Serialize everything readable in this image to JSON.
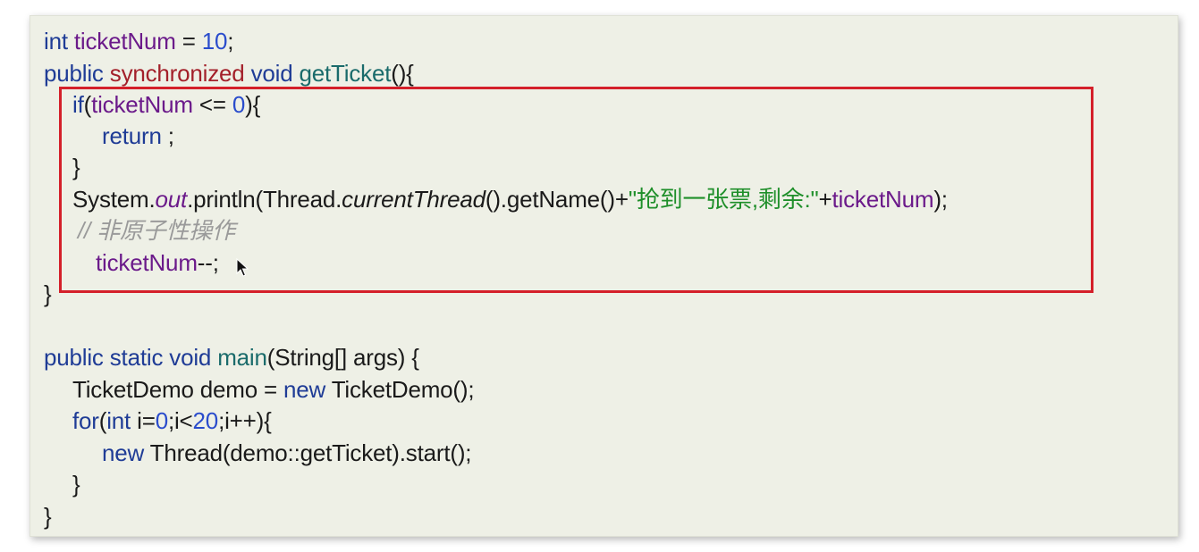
{
  "code": {
    "lines": [
      {
        "tokens": [
          {
            "t": "int",
            "c": "kw"
          },
          {
            "t": " ticketNum ",
            "c": "field"
          },
          {
            "t": "= ",
            "c": ""
          },
          {
            "t": "10",
            "c": "num"
          },
          {
            "t": ";",
            "c": ""
          }
        ]
      },
      {
        "tokens": [
          {
            "t": "public ",
            "c": "kw"
          },
          {
            "t": "synchronized",
            "c": "mod"
          },
          {
            "t": " void ",
            "c": "kw"
          },
          {
            "t": "getTicket",
            "c": "fn"
          },
          {
            "t": "(){",
            "c": ""
          }
        ]
      },
      {
        "tokens": [
          {
            "t": "if",
            "c": "kw"
          },
          {
            "t": "(",
            "c": ""
          },
          {
            "t": "ticketNum",
            "c": "field"
          },
          {
            "t": " <= ",
            "c": ""
          },
          {
            "t": "0",
            "c": "num"
          },
          {
            "t": "){",
            "c": ""
          }
        ]
      },
      {
        "tokens": [
          {
            "t": "return",
            "c": "kw"
          },
          {
            "t": " ;",
            "c": ""
          }
        ]
      },
      {
        "tokens": [
          {
            "t": "}",
            "c": ""
          }
        ]
      },
      {
        "tokens": [
          {
            "t": "System.",
            "c": ""
          },
          {
            "t": "out",
            "c": "fieldit"
          },
          {
            "t": ".println(Thread.",
            "c": ""
          },
          {
            "t": "currentThread",
            "c": "it"
          },
          {
            "t": "().getName()+",
            "c": ""
          },
          {
            "t": "\"抢到一张票,剩余:\"",
            "c": "str"
          },
          {
            "t": "+",
            "c": ""
          },
          {
            "t": "ticketNum",
            "c": "field"
          },
          {
            "t": ");",
            "c": ""
          }
        ]
      },
      {
        "tokens": [
          {
            "t": "// 非原子性操作",
            "c": "comment"
          }
        ]
      },
      {
        "tokens": [
          {
            "t": "ticketNum",
            "c": "field"
          },
          {
            "t": "--;",
            "c": ""
          }
        ]
      },
      {
        "tokens": [
          {
            "t": "}",
            "c": ""
          }
        ]
      },
      {
        "tokens": [
          {
            "t": "public static void ",
            "c": "kw"
          },
          {
            "t": "main",
            "c": "fn"
          },
          {
            "t": "(String[] args) {",
            "c": ""
          }
        ]
      },
      {
        "tokens": [
          {
            "t": "TicketDemo demo = ",
            "c": ""
          },
          {
            "t": "new",
            "c": "kw"
          },
          {
            "t": " TicketDemo();",
            "c": ""
          }
        ]
      },
      {
        "tokens": [
          {
            "t": "for",
            "c": "kw"
          },
          {
            "t": "(",
            "c": ""
          },
          {
            "t": "int",
            "c": "kw"
          },
          {
            "t": " i=",
            "c": ""
          },
          {
            "t": "0",
            "c": "num"
          },
          {
            "t": ";i<",
            "c": ""
          },
          {
            "t": "20",
            "c": "num"
          },
          {
            "t": ";i++){",
            "c": ""
          }
        ]
      },
      {
        "tokens": [
          {
            "t": "new",
            "c": "kw"
          },
          {
            "t": " Thread(demo::getTicket).start();",
            "c": ""
          }
        ]
      },
      {
        "tokens": [
          {
            "t": "}",
            "c": ""
          }
        ]
      },
      {
        "tokens": [
          {
            "t": "}",
            "c": ""
          }
        ]
      }
    ]
  },
  "colors": {
    "keyword": "#1f3c96",
    "modifier": "#a3202a",
    "method": "#1a6b6b",
    "field": "#6b1a8a",
    "number": "#2a4ccc",
    "string": "#1f8f2a",
    "comment": "#9a9a9a",
    "highlight_border": "#d4202a",
    "panel_background": "#eef0e6"
  },
  "icons": {
    "cursor": "mouse-pointer-icon"
  }
}
